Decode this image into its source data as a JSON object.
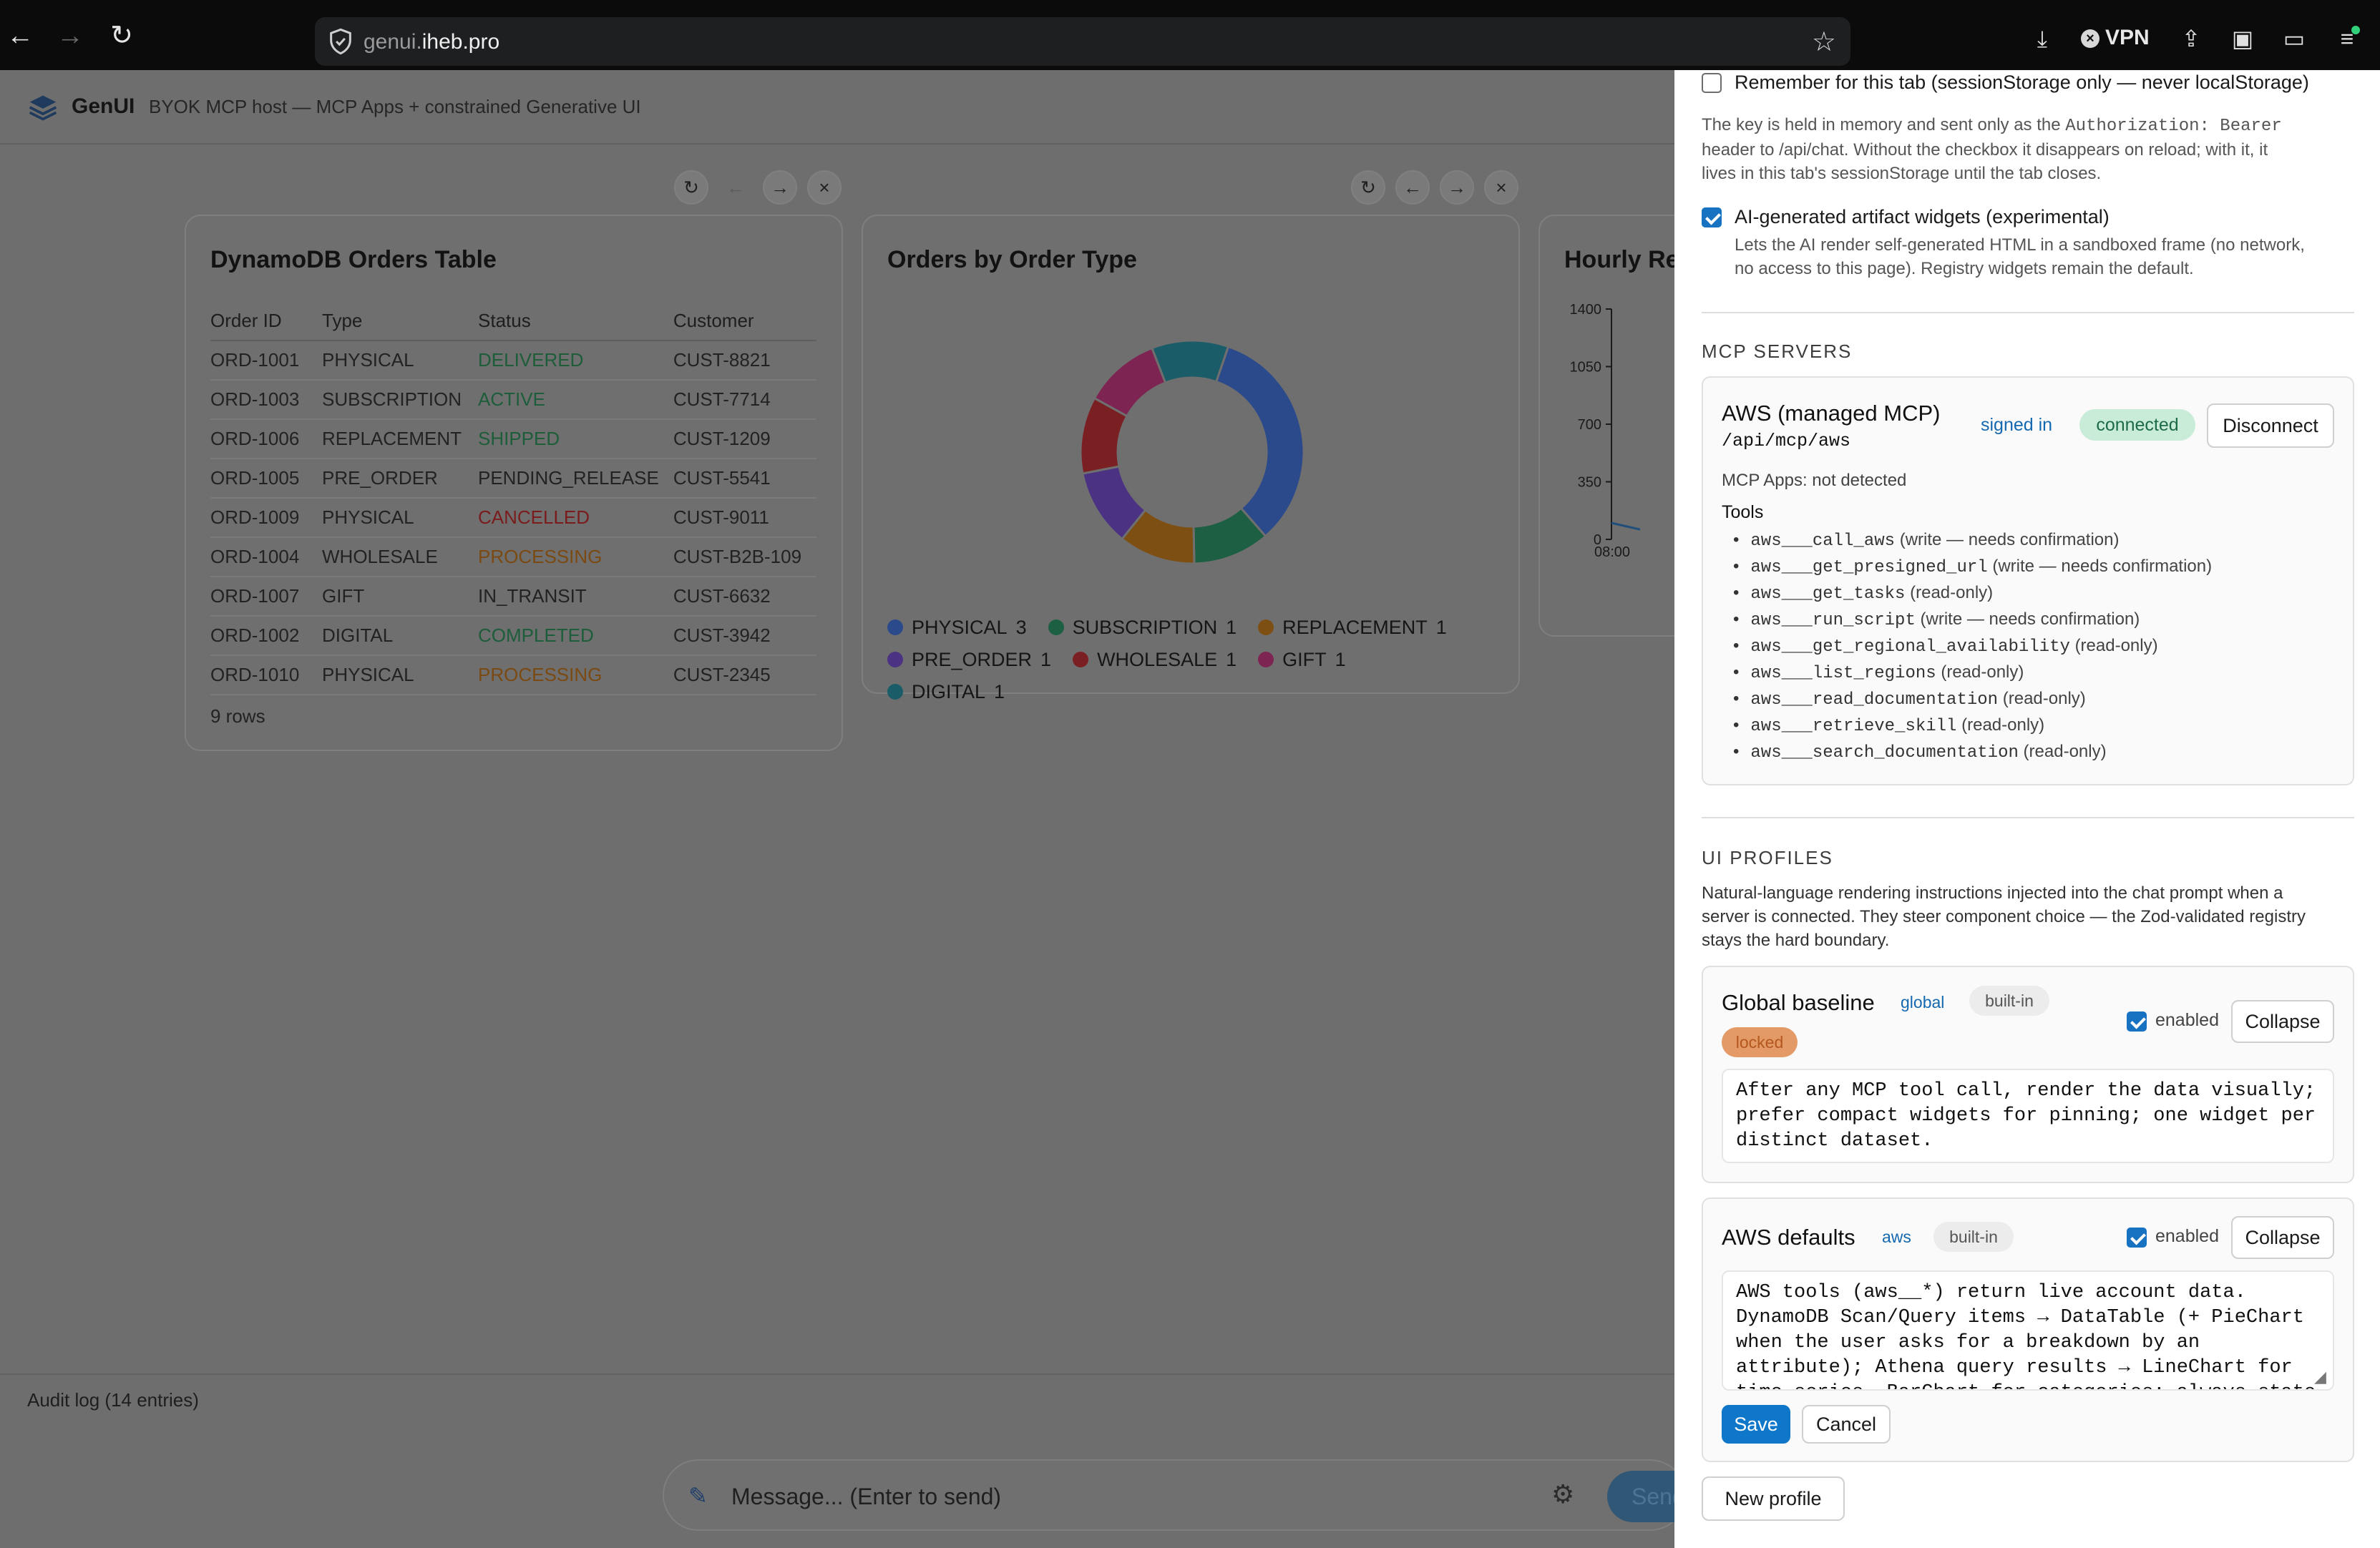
{
  "browser": {
    "url_host_prefix": "genui.",
    "url_host_domain": "iheb.pro",
    "vpn_label": "VPN"
  },
  "app": {
    "name": "GenUI",
    "subtitle": "BYOK MCP host — MCP Apps + constrained Generative UI",
    "audit_label": "Audit log (14 entries)",
    "composer_placeholder": "Message... (Enter to send)",
    "send_label": "Send"
  },
  "table_card": {
    "title": "DynamoDB Orders Table",
    "columns": [
      "Order ID",
      "Type",
      "Status",
      "Customer"
    ],
    "rows": [
      [
        "ORD-1001",
        "PHYSICAL",
        "DELIVERED",
        "CUST-8821"
      ],
      [
        "ORD-1003",
        "SUBSCRIPTION",
        "ACTIVE",
        "CUST-7714"
      ],
      [
        "ORD-1006",
        "REPLACEMENT",
        "SHIPPED",
        "CUST-1209"
      ],
      [
        "ORD-1005",
        "PRE_ORDER",
        "PENDING_RELEASE",
        "CUST-5541"
      ],
      [
        "ORD-1009",
        "PHYSICAL",
        "CANCELLED",
        "CUST-9011"
      ],
      [
        "ORD-1004",
        "WHOLESALE",
        "PROCESSING",
        "CUST-B2B-109"
      ],
      [
        "ORD-1007",
        "GIFT",
        "IN_TRANSIT",
        "CUST-6632"
      ],
      [
        "ORD-1002",
        "DIGITAL",
        "COMPLETED",
        "CUST-3942"
      ],
      [
        "ORD-1010",
        "PHYSICAL",
        "PROCESSING",
        "CUST-2345"
      ]
    ],
    "status_colors": {
      "DELIVERED": "green",
      "ACTIVE": "green",
      "SHIPPED": "green",
      "COMPLETED": "green",
      "CANCELLED": "red",
      "PROCESSING": "orange"
    },
    "rows_note": "9 rows"
  },
  "chart_data": [
    {
      "type": "pie",
      "title": "Orders by Order Type",
      "categories": [
        "PHYSICAL",
        "SUBSCRIPTION",
        "REPLACEMENT",
        "PRE_ORDER",
        "WHOLESALE",
        "GIFT",
        "DIGITAL"
      ],
      "values": [
        3,
        1,
        1,
        1,
        1,
        1,
        1
      ],
      "colors": [
        "#2b4a8c",
        "#1d5f43",
        "#7d4f12",
        "#4b3283",
        "#7a1f22",
        "#7e2452",
        "#1a5d68"
      ],
      "legend_placement": "bottom"
    },
    {
      "type": "line",
      "title": "Hourly Re",
      "yticks": [
        0,
        350,
        700,
        1050,
        1400
      ],
      "ylim": [
        0,
        1400
      ],
      "xticks": [
        "08:00"
      ]
    }
  ],
  "panel": {
    "remember_label": "Remember for this tab (sessionStorage only — never localStorage)",
    "key_note_1": "The key is held in memory and sent only as the ",
    "key_note_code": "Authorization: Bearer",
    "key_note_2": "header to /api/chat. Without the checkbox it disappears on reload; with it, it",
    "key_note_3": "lives in this tab's sessionStorage until the tab closes.",
    "ai_widgets_label": "AI-generated artifact widgets (experimental)",
    "ai_widgets_note_1": "Lets the AI render self-generated HTML in a sandboxed frame (no network,",
    "ai_widgets_note_2": "no access to this page). Registry widgets remain the default.",
    "mcp_heading": "MCP SERVERS",
    "server": {
      "name": "AWS (managed MCP)",
      "path": "/api/mcp/aws",
      "signed_in": "signed in",
      "status": "connected",
      "disconnect": "Disconnect",
      "apps_note": "MCP Apps: not detected",
      "tools_heading": "Tools",
      "tools": [
        {
          "name": "aws___call_aws",
          "mode": "(write — needs confirmation)"
        },
        {
          "name": "aws___get_presigned_url",
          "mode": "(write — needs confirmation)"
        },
        {
          "name": "aws___get_tasks",
          "mode": "(read-only)"
        },
        {
          "name": "aws___run_script",
          "mode": "(write — needs confirmation)"
        },
        {
          "name": "aws___get_regional_availability",
          "mode": "(read-only)"
        },
        {
          "name": "aws___list_regions",
          "mode": "(read-only)"
        },
        {
          "name": "aws___read_documentation",
          "mode": "(read-only)"
        },
        {
          "name": "aws___retrieve_skill",
          "mode": "(read-only)"
        },
        {
          "name": "aws___search_documentation",
          "mode": "(read-only)"
        }
      ]
    },
    "profiles_heading": "UI PROFILES",
    "profiles_note_1": "Natural-language rendering instructions injected into the chat prompt when a",
    "profiles_note_2": "server is connected. They steer component choice — the Zod-validated registry",
    "profiles_note_3": "stays the hard boundary.",
    "profiles": [
      {
        "name": "Global baseline",
        "scope": "global",
        "origin": "built-in",
        "locked": "locked",
        "enabled_label": "enabled",
        "collapse_label": "Collapse",
        "text": "After any MCP tool call, render the data visually;\nprefer compact widgets for pinning; one widget per\ndistinct dataset."
      },
      {
        "name": "AWS defaults",
        "scope": "aws",
        "origin": "built-in",
        "enabled_label": "enabled",
        "collapse_label": "Collapse",
        "text": "AWS tools (aws__*) return live account data.\nDynamoDB Scan/Query items → DataTable (+ PieChart\nwhen the user asks for a breakdown by an\nattribute); Athena query results → LineChart for\ntime series, BarChart for categories; always state"
      }
    ],
    "save_label": "Save",
    "cancel_label": "Cancel",
    "new_profile_label": "New profile"
  }
}
